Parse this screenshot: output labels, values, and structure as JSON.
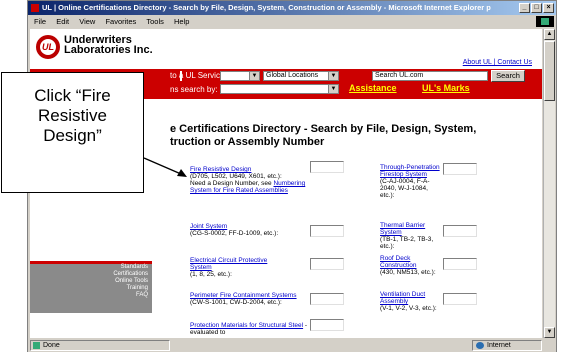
{
  "window": {
    "title": "UL | Online Certifications Directory - Search by File, Design, System, Construction or Assembly - Microsoft Internet Explorer p",
    "buttons": [
      "_",
      "□",
      "×"
    ]
  },
  "menu": [
    "File",
    "Edit",
    "View",
    "Favorites",
    "Tools",
    "Help"
  ],
  "header": {
    "brand_line1": "Underwriters",
    "brand_line2": "Laboratories Inc.",
    "logo_text": "UL",
    "top_links": "About UL | Contact Us"
  },
  "redbar": {
    "service_label": "to a UL Service:",
    "search_by_label": "ns search by:",
    "global_locations": "Global Locations",
    "search_placeholder": "Search UL.com",
    "search_button": "Search",
    "assistance": "Assistance",
    "marks": "UL's Marks"
  },
  "heading": {
    "line1": "e Certifications Directory - Search by File, Design, System,",
    "line2": "truction or Assembly Number"
  },
  "left_nav": [
    "Standards",
    "Certifications",
    "Online Tools",
    "Training",
    "FAQ"
  ],
  "links_left": [
    {
      "title": "Fire Resistive Design",
      "desc": "(D705, L502, U649, X601, etc.):",
      "extra": "Need a Design Number, see ",
      "extra_link": "Numbering System for Fire Rated Assemblies"
    },
    {
      "title": "Joint System",
      "desc": "(CG-S-0002, FF-D-1009, etc.):"
    },
    {
      "title": "Electrical Circuit Protective System",
      "desc": "(1, 8, 25, etc.):"
    },
    {
      "title": "Perimeter Fire Containment Systems",
      "desc": "(CW-S-1001, CW-D-2004, etc.):"
    },
    {
      "title": "Protection Materials for Structural Steel",
      "desc": " - evaluated to"
    }
  ],
  "links_right": [
    {
      "title": "Through-Penetration Firestop System",
      "desc": "(C-AJ-0004, F-A-2040, W-J-1084, etc.):"
    },
    {
      "title": "Thermal Barrier System",
      "desc": "(TB-1, TB-2, TB-3, etc.):"
    },
    {
      "title": "Roof Deck Construction",
      "desc": "(430, NM513, etc.):"
    },
    {
      "title": "Ventilation Duct Assembly",
      "desc": "(V-1, V-2, V-3, etc.):"
    }
  ],
  "status": {
    "left": "Done",
    "right": "Internet"
  },
  "callout": {
    "line1": "Click “Fire",
    "line2": "Resistive",
    "line3": "Design”"
  }
}
